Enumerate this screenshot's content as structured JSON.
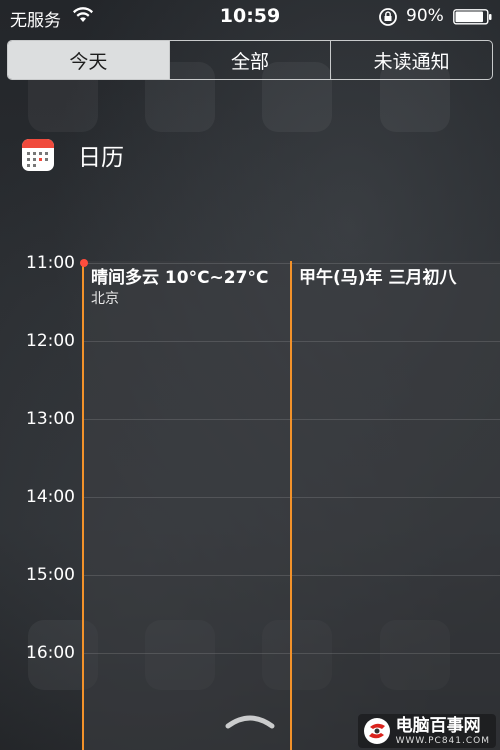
{
  "status_bar": {
    "carrier": "无服务",
    "time": "10:59",
    "battery": "90%"
  },
  "segments": [
    {
      "label": "今天",
      "selected": true
    },
    {
      "label": "全部",
      "selected": false
    },
    {
      "label": "未读通知",
      "selected": false
    }
  ],
  "widget": {
    "title": "日历"
  },
  "timeline": {
    "hours": [
      "11:00",
      "12:00",
      "13:00",
      "14:00",
      "15:00",
      "16:00"
    ]
  },
  "events": [
    {
      "title": "晴间多云 10°C~27°C",
      "location": "北京"
    },
    {
      "title": "甲午(马)年 三月初八"
    }
  ],
  "watermark": {
    "name": "电脑百事网",
    "url": "WWW.PC841.COM"
  },
  "colors": {
    "event_border": "#f3922a",
    "now_dot": "#ff4d3d",
    "segment_selected_bg": "#dcdedf"
  }
}
